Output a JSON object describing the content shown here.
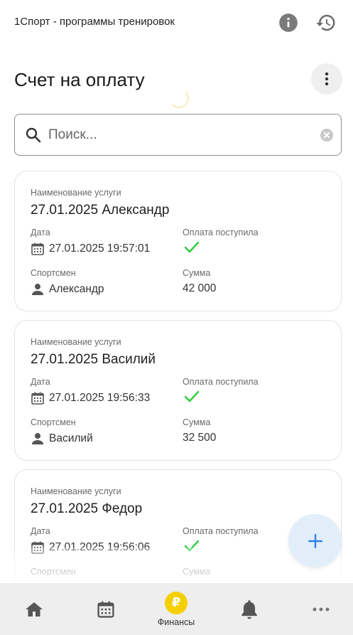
{
  "app": {
    "title": "1Спорт - программы тренировок"
  },
  "page": {
    "title": "Счет на оплату"
  },
  "search": {
    "placeholder": "Поиск...",
    "value": ""
  },
  "labels": {
    "service": "Наименование услуги",
    "date": "Дата",
    "paid": "Оплата поступила",
    "athlete": "Спортсмен",
    "amount": "Сумма"
  },
  "invoices": [
    {
      "service": "27.01.2025 Александр",
      "date": "27.01.2025 19:57:01",
      "paid": true,
      "athlete": "Александр",
      "amount": "42 000"
    },
    {
      "service": "27.01.2025 Василий",
      "date": "27.01.2025 19:56:33",
      "paid": true,
      "athlete": "Василий",
      "amount": "32 500"
    },
    {
      "service": "27.01.2025 Федор",
      "date": "27.01.2025 19:56:06",
      "paid": true,
      "athlete": "",
      "amount": ""
    }
  ],
  "nav": {
    "items": [
      {
        "icon": "home-icon"
      },
      {
        "icon": "calendar-icon"
      },
      {
        "icon": "ruble-icon",
        "label": "Финансы",
        "active": true
      },
      {
        "icon": "bell-icon"
      },
      {
        "icon": "more-horizontal-icon"
      }
    ]
  },
  "colors": {
    "accent": "#f5d000",
    "check": "#2ecc40",
    "fab_bg": "#e2eef9",
    "fab_icon": "#2f80ed",
    "nav_bg": "#eeeeee"
  }
}
